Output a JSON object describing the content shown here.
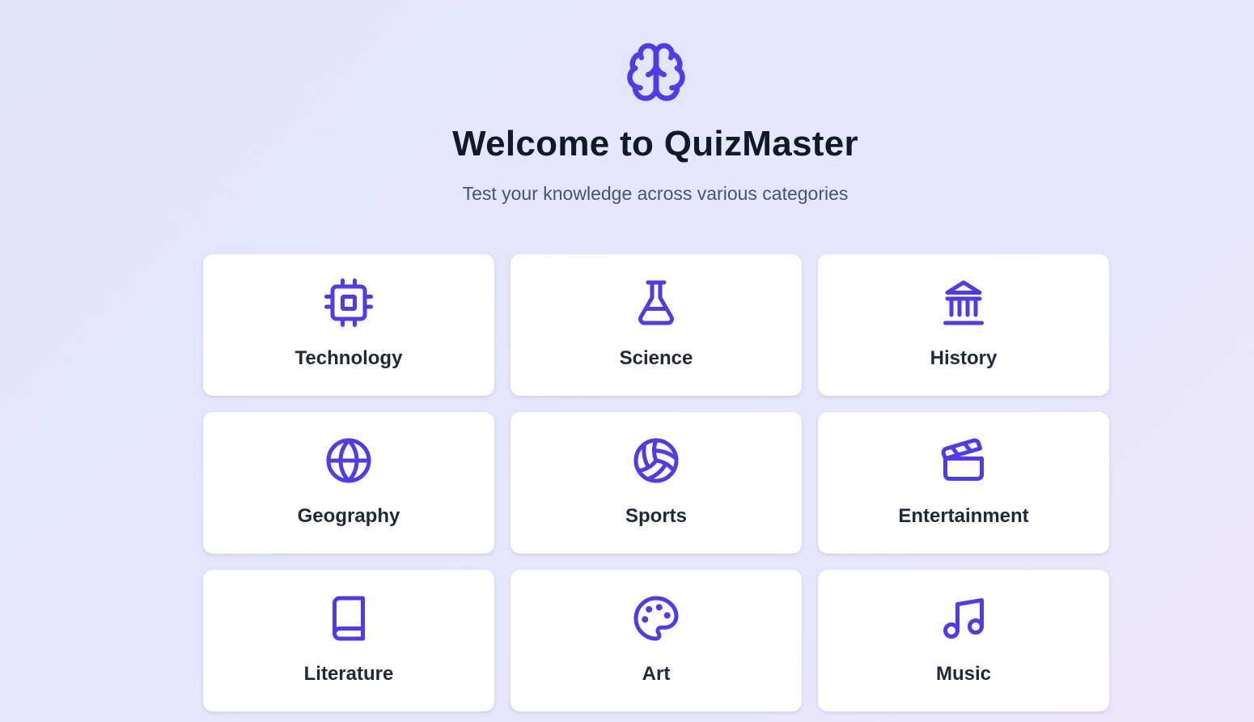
{
  "header": {
    "logo_icon": "brain-icon",
    "title": "Welcome to QuizMaster",
    "subtitle": "Test your knowledge across various categories"
  },
  "theme": {
    "accent": "#4f3ce8",
    "title_color": "#111827",
    "subtitle_color": "#4b5563",
    "card_background": "#ffffff"
  },
  "categories": [
    {
      "label": "Technology",
      "icon": "cpu-chip-icon"
    },
    {
      "label": "Science",
      "icon": "flask-icon"
    },
    {
      "label": "History",
      "icon": "museum-icon"
    },
    {
      "label": "Geography",
      "icon": "globe-icon"
    },
    {
      "label": "Sports",
      "icon": "volleyball-icon"
    },
    {
      "label": "Entertainment",
      "icon": "clapperboard-icon"
    },
    {
      "label": "Literature",
      "icon": "book-icon"
    },
    {
      "label": "Art",
      "icon": "palette-icon"
    },
    {
      "label": "Music",
      "icon": "music-note-icon"
    }
  ]
}
